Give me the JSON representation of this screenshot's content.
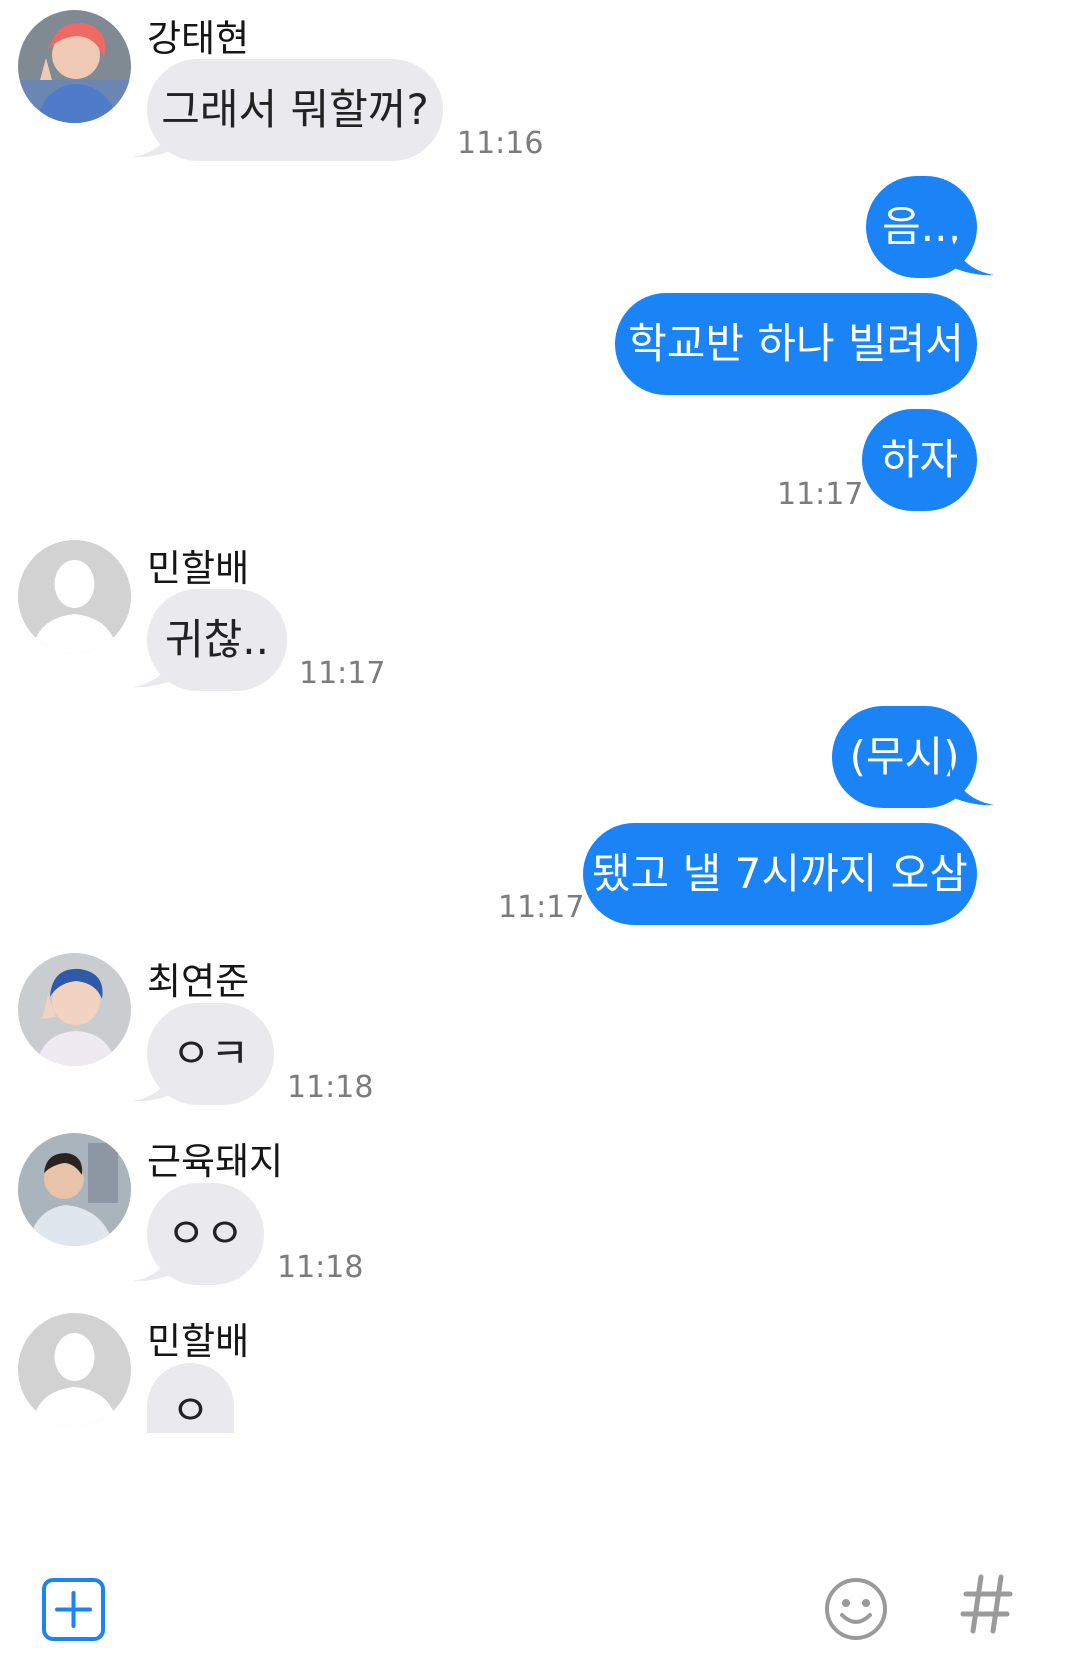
{
  "messages": [
    {
      "kind": "incoming",
      "sender": "강태현",
      "avatar": "photo-avatar",
      "text": "그래서 뭐할꺼?",
      "time": "11:16"
    },
    {
      "kind": "outgoing",
      "text": "음..,"
    },
    {
      "kind": "outgoing",
      "text": "학교반 하나 빌려서"
    },
    {
      "kind": "outgoing",
      "text": "하자",
      "time": "11:17"
    },
    {
      "kind": "incoming",
      "sender": "민할배",
      "avatar": "default-person-avatar",
      "text": "귀찮..",
      "time": "11:17"
    },
    {
      "kind": "outgoing",
      "text": "(무시)"
    },
    {
      "kind": "outgoing",
      "text": "됐고 낼 7시까지 오삼",
      "time": "11:17"
    },
    {
      "kind": "incoming",
      "sender": "최연준",
      "avatar": "photo-avatar",
      "text": "ㅇㅋ",
      "time": "11:18"
    },
    {
      "kind": "incoming",
      "sender": "근육돼지",
      "avatar": "photo-avatar",
      "text": "ㅇㅇ",
      "time": "11:18"
    },
    {
      "kind": "incoming",
      "sender": "민할배",
      "avatar": "default-person-avatar",
      "text": "ㅇ"
    }
  ],
  "composer": {
    "attach_icon": "plus-square-icon",
    "emoji_icon": "smiley-icon",
    "hashtag_icon": "hash-icon"
  },
  "colors": {
    "outgoing_bubble": "#1a84f7",
    "incoming_bubble": "#e9e9ee",
    "timestamp": "#7c7c7c",
    "composer_icon_gray": "#9a9a9a"
  }
}
